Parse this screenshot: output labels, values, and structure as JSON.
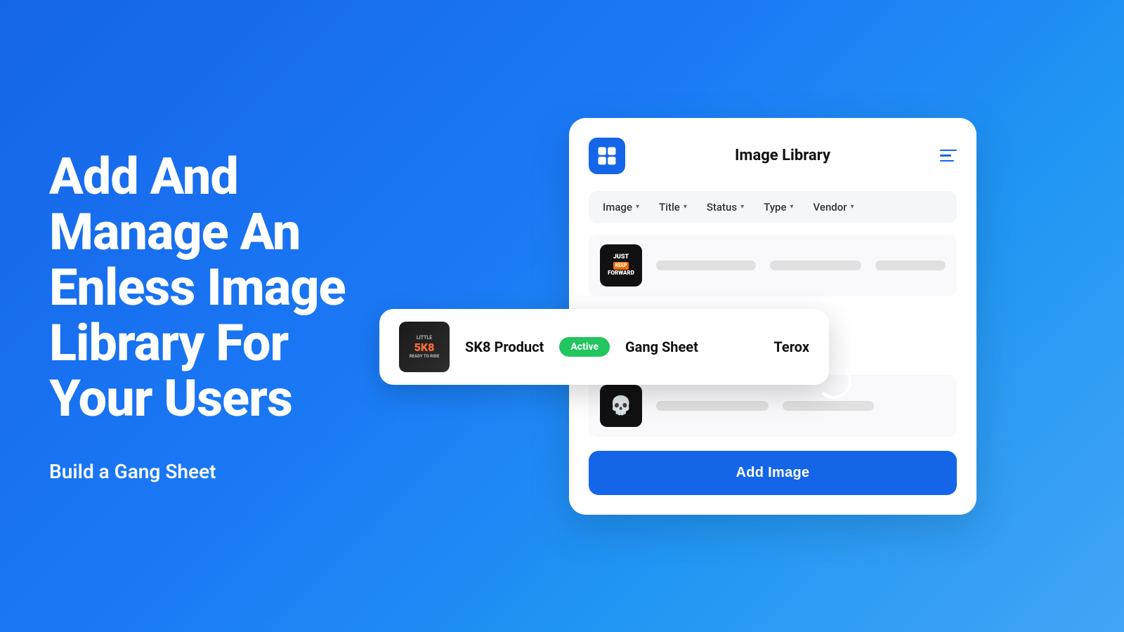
{
  "left": {
    "main_heading": "Add And Manage An Enless Image Library For Your Users",
    "sub_heading": "Build a Gang Sheet"
  },
  "panel": {
    "title": "Image Library",
    "logo_alt": "app-logo",
    "menu_alt": "menu-icon",
    "filters": [
      {
        "label": "Image"
      },
      {
        "label": "Title"
      },
      {
        "label": "Status"
      },
      {
        "label": "Type"
      },
      {
        "label": "Vendor"
      }
    ],
    "rows": [
      {
        "id": "row-1",
        "image_type": "just-keep",
        "title": "",
        "status": "",
        "type": "",
        "vendor": "",
        "skeleton": true
      },
      {
        "id": "row-2",
        "image_type": "sk8",
        "title": "SK8 Product",
        "status": "Active",
        "type": "Gang Sheet",
        "vendor": "Terox",
        "skeleton": false,
        "highlighted": true
      },
      {
        "id": "row-3",
        "image_type": "skull",
        "title": "",
        "status": "",
        "type": "",
        "vendor": "",
        "skeleton": true
      }
    ],
    "add_button_label": "Add Image"
  }
}
